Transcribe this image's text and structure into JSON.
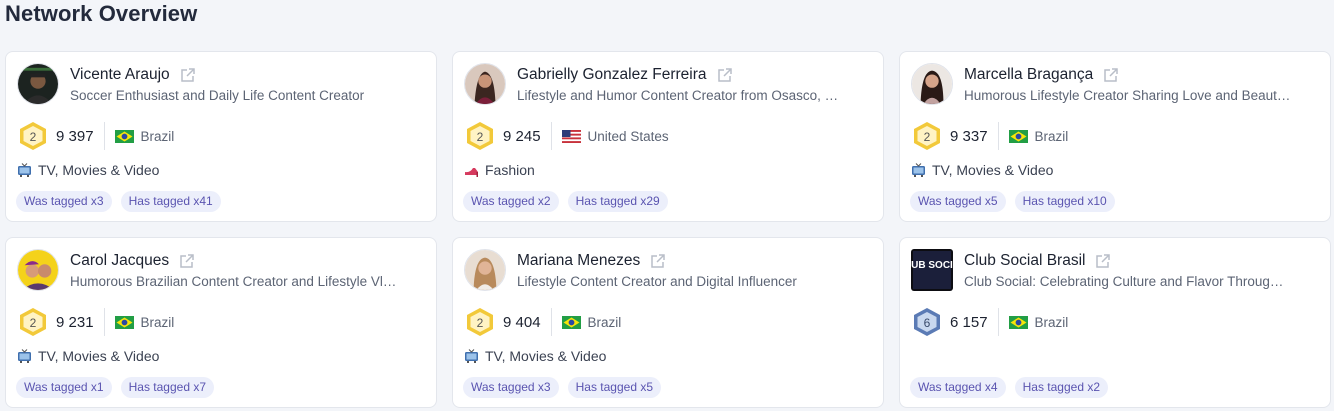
{
  "page": {
    "title": "Network Overview"
  },
  "cards": [
    {
      "name": "Vicente Araujo",
      "description": "Soccer Enthusiast and Daily Life Content Creator",
      "level": "2",
      "count": "9 397",
      "country": "Brazil",
      "category": "TV, Movies & Video",
      "was_tagged": "Was tagged x3",
      "has_tagged": "Has tagged x41"
    },
    {
      "name": "Gabrielly Gonzalez Ferreira",
      "description": "Lifestyle and Humor Content Creator from Osasco, …",
      "level": "2",
      "count": "9 245",
      "country": "United States",
      "category": "Fashion",
      "was_tagged": "Was tagged x2",
      "has_tagged": "Has tagged x29"
    },
    {
      "name": "Marcella Bragança",
      "description": "Humorous Lifestyle Creator Sharing Love and Beaut…",
      "level": "2",
      "count": "9 337",
      "country": "Brazil",
      "category": "TV, Movies & Video",
      "was_tagged": "Was tagged x5",
      "has_tagged": "Has tagged x10"
    },
    {
      "name": "Carol Jacques",
      "description": "Humorous Brazilian Content Creator and Lifestyle Vl…",
      "level": "2",
      "count": "9 231",
      "country": "Brazil",
      "category": "TV, Movies & Video",
      "was_tagged": "Was tagged x1",
      "has_tagged": "Has tagged x7"
    },
    {
      "name": "Mariana Menezes",
      "description": "Lifestyle Content Creator and Digital Influencer",
      "level": "2",
      "count": "9 404",
      "country": "Brazil",
      "category": "TV, Movies & Video",
      "was_tagged": "Was tagged x3",
      "has_tagged": "Has tagged x5"
    },
    {
      "name": "Club Social Brasil",
      "description": "Club Social: Celebrating Culture and Flavor Throug…",
      "logo_text": "CLUB SOCIAL",
      "level": "6",
      "count": "6 157",
      "country": "Brazil",
      "category": "",
      "was_tagged": "Was tagged x4",
      "has_tagged": "Has tagged x2"
    }
  ],
  "icons": {
    "external_link": "external-link-icon",
    "level_badge_gold": "hexagon-badge-gold",
    "level_badge_blue": "hexagon-badge-blue",
    "tv": "tv-icon",
    "fashion": "high-heel-icon"
  },
  "colors": {
    "tag_bg": "#eceffb",
    "tag_text": "#5a54b0",
    "badge_gold": "#f2c93a",
    "badge_blue": "#5b7bb5"
  }
}
